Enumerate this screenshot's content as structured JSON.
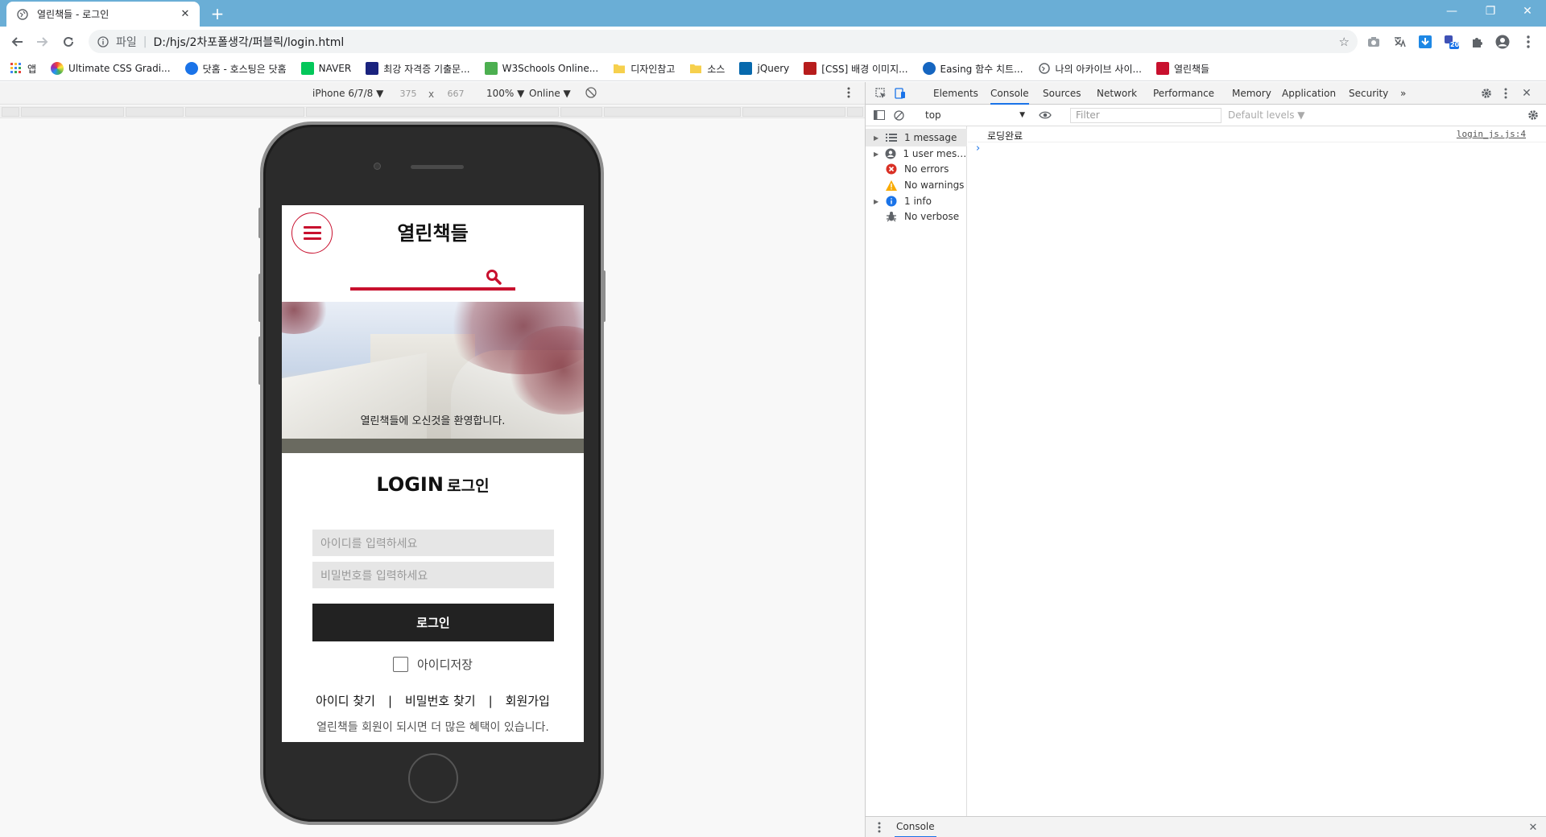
{
  "browser": {
    "tab_title": "열린책들 - 로그인",
    "address_scheme": "파일",
    "address_url": "D:/hjs/2차포폴생각/퍼블릭/login.html",
    "extension_badge": "20",
    "bookmarks": [
      {
        "label": "앱",
        "icon": "apps-grid-icon",
        "color": "#e8453c"
      },
      {
        "label": "Ultimate CSS Gradi...",
        "icon": "gradient-icon",
        "color": "#a142f4"
      },
      {
        "label": "닷홈 - 호스팅은 닷홈",
        "icon": "dothome-icon",
        "color": "#1a73e8"
      },
      {
        "label": "NAVER",
        "icon": "naver-icon",
        "color": "#03c75a"
      },
      {
        "label": "최강 자격증 기출문...",
        "icon": "csc-icon",
        "color": "#1a237e"
      },
      {
        "label": "W3Schools Online...",
        "icon": "w3schools-icon",
        "color": "#4caf50"
      },
      {
        "label": "디자인참고",
        "icon": "folder-icon",
        "color": "#f6d04d"
      },
      {
        "label": "소스",
        "icon": "folder-icon",
        "color": "#f6d04d"
      },
      {
        "label": "jQuery",
        "icon": "jquery-icon",
        "color": "#0769ad"
      },
      {
        "label": "[CSS] 배경 이미지...",
        "icon": "tistory-icon",
        "color": "#b71c1c"
      },
      {
        "label": "Easing 함수 치트...",
        "icon": "easing-icon",
        "color": "#1565c0"
      },
      {
        "label": "나의 아카이브 사이...",
        "icon": "globe-icon",
        "color": "#5f6368"
      },
      {
        "label": "열린책들",
        "icon": "openbooks-icon",
        "color": "#c8102e"
      }
    ]
  },
  "device_toolbar": {
    "device": "iPhone 6/7/8 ▼",
    "width": "375",
    "times": "x",
    "height": "667",
    "zoom": "100% ▼",
    "network": "Online ▼"
  },
  "site": {
    "logo": "열린책들",
    "hero_text": "열린책들에 오신것을 환영합니다.",
    "login_title_en": "LOGIN",
    "login_title_ko": "로그인",
    "id_placeholder": "아이디를 입력하세요",
    "pw_placeholder": "비밀번호를 입력하세요",
    "login_button": "로그인",
    "remember_label": "아이디저장",
    "link_find_id": "아이디 찾기",
    "link_find_pw": "비밀번호 찾기",
    "link_join": "회원가입",
    "divider": "|",
    "member_note": "열린책들 회원이 되시면 더 많은 혜택이 있습니다.",
    "accent_color": "#c8102e"
  },
  "devtools": {
    "tabs": [
      "Elements",
      "Console",
      "Sources",
      "Network",
      "Performance",
      "Memory",
      "Application",
      "Security",
      "»"
    ],
    "active_tab": "Console",
    "context": "top",
    "filter_placeholder": "Filter",
    "levels": "Default levels ▼",
    "sidebar": [
      {
        "label": "1 message",
        "icon": "list-icon",
        "expandable": true,
        "selected": true
      },
      {
        "label": "1 user mess...",
        "icon": "user-icon",
        "expandable": true,
        "selected": false
      },
      {
        "label": "No errors",
        "icon": "error-icon",
        "expandable": false,
        "selected": false
      },
      {
        "label": "No warnings",
        "icon": "warning-icon",
        "expandable": false,
        "selected": false
      },
      {
        "label": "1 info",
        "icon": "info-icon",
        "expandable": true,
        "selected": false
      },
      {
        "label": "No verbose",
        "icon": "bug-icon",
        "expandable": false,
        "selected": false
      }
    ],
    "log_message": "로딩완료",
    "log_source": "login_js.js:4",
    "prompt": "›",
    "drawer_tab": "Console"
  }
}
